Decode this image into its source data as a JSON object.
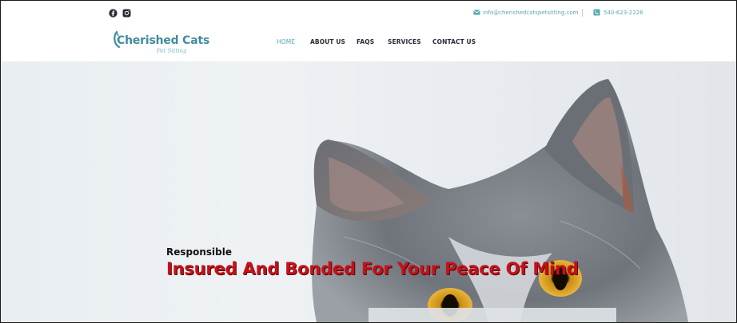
{
  "topbar": {
    "social_icons": [
      "facebook-icon",
      "instagram-icon"
    ],
    "email": "info@cherishedcatspetsitting.com",
    "phone": "540-623-2226"
  },
  "brand": {
    "name": "Cherished Cats",
    "tagline": "Pet Sitting",
    "color": "#3f8c9d"
  },
  "nav": {
    "items": [
      {
        "label": "HOME",
        "active": true
      },
      {
        "label": "ABOUT US",
        "active": false
      },
      {
        "label": "FAQS",
        "active": false
      },
      {
        "label": "SERVICES",
        "active": false
      },
      {
        "label": "CONTACT US",
        "active": false
      }
    ]
  },
  "hero": {
    "subtitle": "Responsible",
    "headline": "Insured And Bonded For Your Peace Of Mind",
    "headline_color": "#c3121b",
    "image": "grey-cat-photo"
  },
  "colors": {
    "accent": "#5aa9b8",
    "nav_text": "#2a2a3a"
  }
}
